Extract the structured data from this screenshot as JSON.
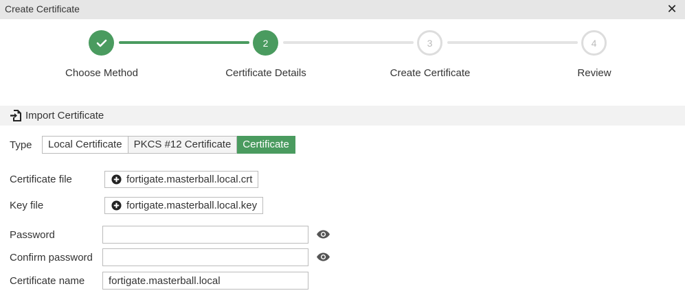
{
  "dialog": {
    "title": "Create Certificate",
    "close_icon": "close-icon"
  },
  "stepper": {
    "steps": [
      {
        "label": "Choose Method",
        "number": "1",
        "state": "done"
      },
      {
        "label": "Certificate Details",
        "number": "2",
        "state": "active"
      },
      {
        "label": "Create Certificate",
        "number": "3",
        "state": "todo"
      },
      {
        "label": "Review",
        "number": "4",
        "state": "todo"
      }
    ]
  },
  "section": {
    "title": "Import Certificate",
    "icon": "import-icon"
  },
  "form": {
    "type_label": "Type",
    "type_options": [
      "Local Certificate",
      "PKCS #12 Certificate",
      "Certificate"
    ],
    "type_selected": "Certificate",
    "cert_file_label": "Certificate file",
    "cert_file_value": "fortigate.masterball.local.crt",
    "key_file_label": "Key file",
    "key_file_value": "fortigate.masterball.local.key",
    "password_label": "Password",
    "password_value": "",
    "confirm_password_label": "Confirm password",
    "confirm_password_value": "",
    "cert_name_label": "Certificate name",
    "cert_name_value": "fortigate.masterball.local"
  },
  "colors": {
    "accent": "#4a9b5f",
    "inactive_step": "#dddddd",
    "header_bg": "#e6e6e6",
    "section_bg": "#f2f2f2"
  }
}
